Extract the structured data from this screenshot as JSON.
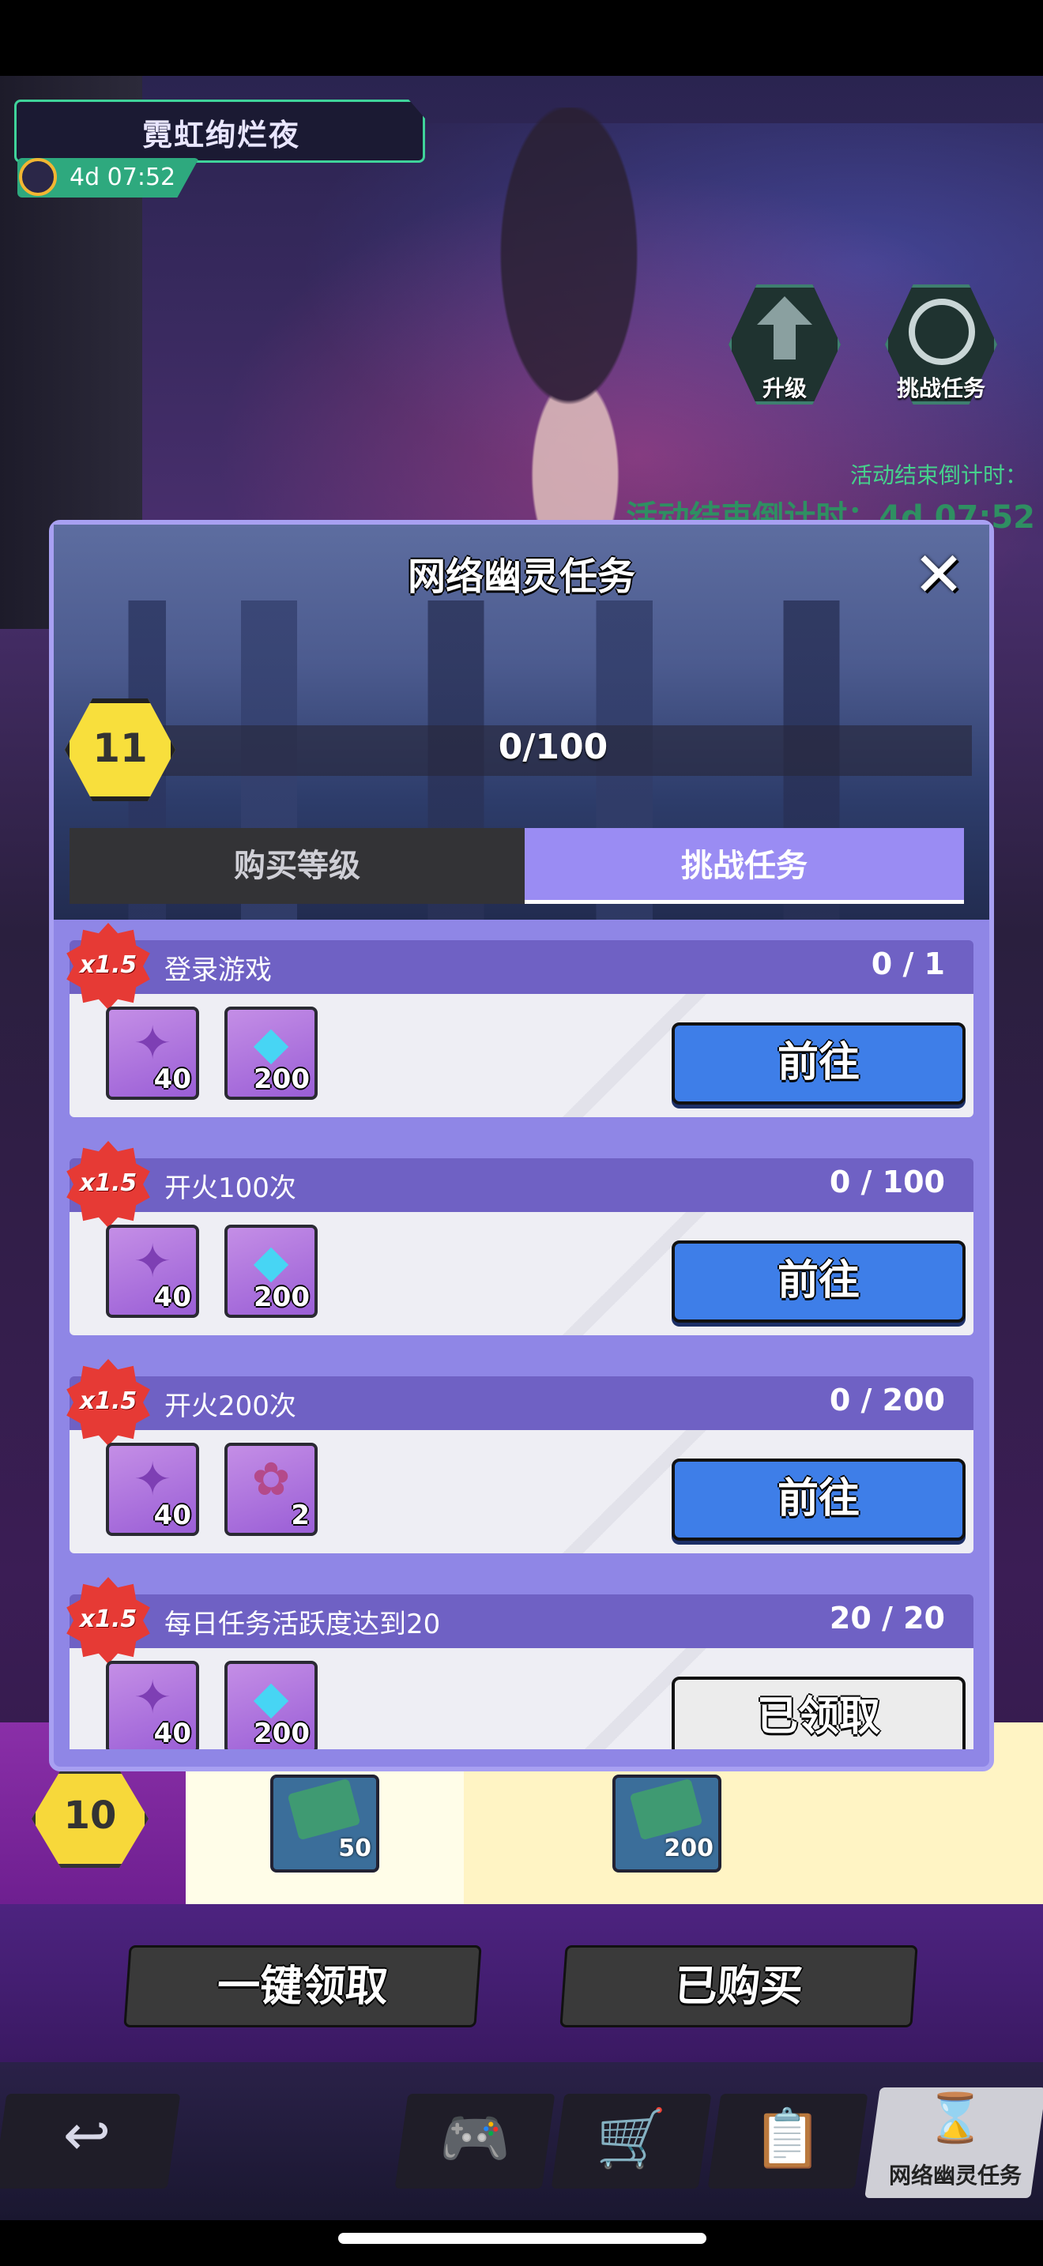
{
  "event": {
    "title": "霓虹绚烂夜",
    "timer": "4d 07:52"
  },
  "side_buttons": {
    "upgrade_label": "升级",
    "challenge_label": "挑战任务"
  },
  "countdown": {
    "small": "活动结束倒计时：",
    "big": "活动结束倒计时：4d 07:52"
  },
  "modal": {
    "title": "网络幽灵任务",
    "level": "11",
    "progress": "0/100",
    "tabs": [
      {
        "label": "购买等级",
        "active": false
      },
      {
        "label": "挑战任务",
        "active": true
      }
    ]
  },
  "tasks": [
    {
      "multiplier": "x1.5",
      "name": "登录游戏",
      "progress": "0 / 1",
      "rewards": [
        {
          "icon": "ticket-icon",
          "count": "40"
        },
        {
          "icon": "diamond-icon",
          "count": "200"
        }
      ],
      "button": "前往",
      "claimed": false
    },
    {
      "multiplier": "x1.5",
      "name": "开火100次",
      "progress": "0 / 100",
      "rewards": [
        {
          "icon": "ticket-icon",
          "count": "40"
        },
        {
          "icon": "diamond-icon",
          "count": "200"
        }
      ],
      "button": "前往",
      "claimed": false
    },
    {
      "multiplier": "x1.5",
      "name": "开火200次",
      "progress": "0 / 200",
      "rewards": [
        {
          "icon": "ticket-icon",
          "count": "40"
        },
        {
          "icon": "coupon-icon",
          "count": "2"
        }
      ],
      "button": "前往",
      "claimed": false
    },
    {
      "multiplier": "x1.5",
      "name": "每日任务活跃度达到20",
      "progress": "20 / 20",
      "rewards": [
        {
          "icon": "ticket-icon",
          "count": "40"
        },
        {
          "icon": "diamond-icon",
          "count": "200"
        }
      ],
      "button": "已领取",
      "claimed": true
    }
  ],
  "background_row": {
    "level": "10",
    "items": [
      {
        "icon": "supply-crate-icon",
        "count": "50"
      },
      {
        "icon": "supply-crate-icon",
        "count": "200"
      }
    ]
  },
  "bottom_actions": {
    "claim_all": "一键领取",
    "purchased": "已购买"
  },
  "nav": {
    "back_icon": "back-arrow-icon",
    "items": [
      "gamepad-icon",
      "cart-icon",
      "clipboard-check-icon"
    ],
    "active_label": "网络幽灵任务",
    "active_icon": "hourglass-icon"
  },
  "colors": {
    "modal_bg": "#8f86e6",
    "task_header": "#6f61c4",
    "go_button": "#3e7ee8",
    "multiplier_badge": "#e63a35",
    "level_badge": "#f8df3c",
    "event_accent": "#3fd39a"
  }
}
